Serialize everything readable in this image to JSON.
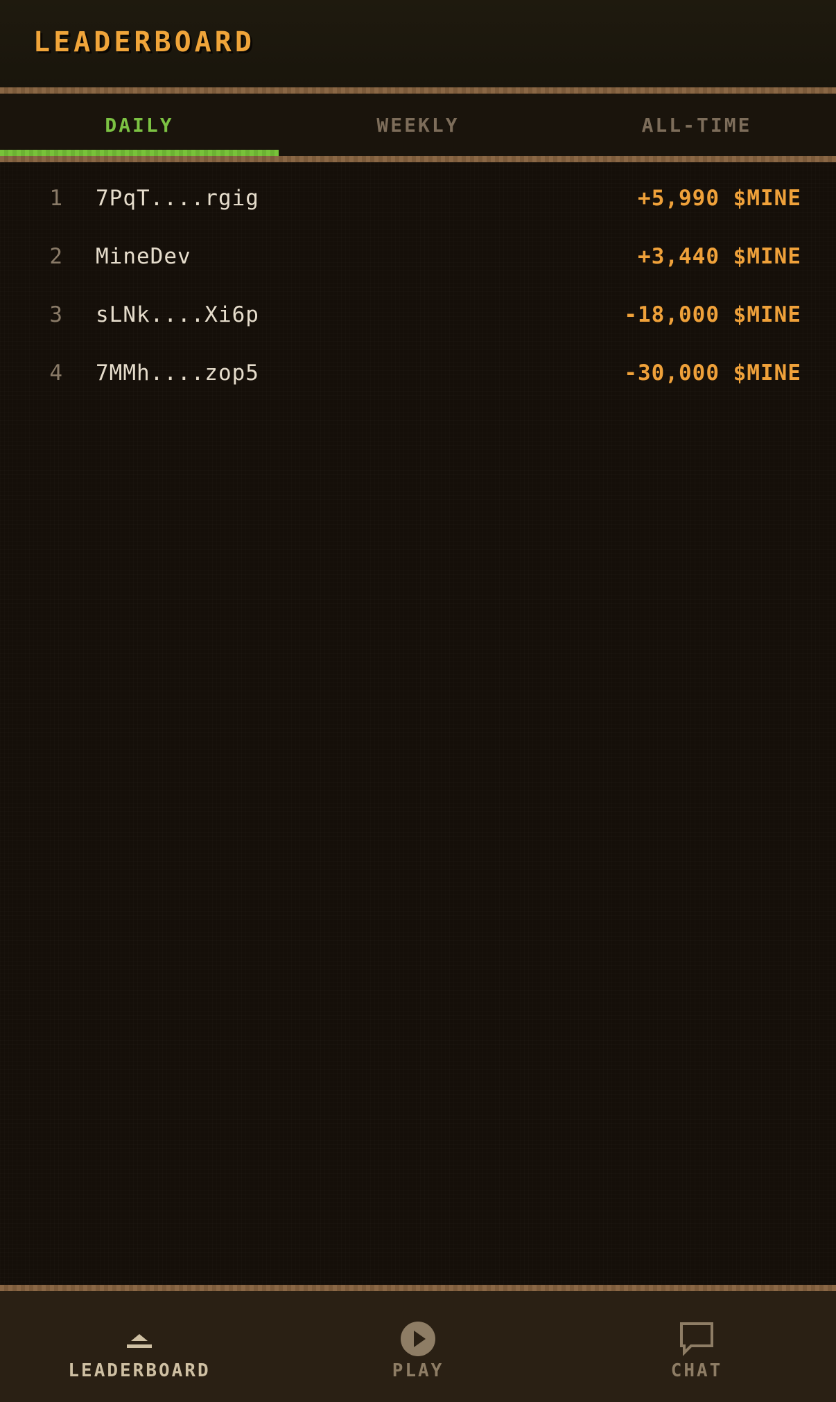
{
  "header": {
    "title": "LEADERBOARD"
  },
  "tabs": [
    {
      "label": "DAILY",
      "active": true
    },
    {
      "label": "WEEKLY",
      "active": false
    },
    {
      "label": "ALL-TIME",
      "active": false
    }
  ],
  "leaderboard": [
    {
      "rank": "1",
      "player": "7PqT....rgig",
      "score": "+5,990 $MINE"
    },
    {
      "rank": "2",
      "player": "MineDev",
      "score": "+3,440 $MINE"
    },
    {
      "rank": "3",
      "player": "sLNk....Xi6p",
      "score": "-18,000 $MINE"
    },
    {
      "rank": "4",
      "player": "7MMh....zop5",
      "score": "-30,000 $MINE"
    }
  ],
  "nav": [
    {
      "label": "LEADERBOARD",
      "icon": "leaderboard-icon",
      "active": true
    },
    {
      "label": "PLAY",
      "icon": "play-icon",
      "active": false
    },
    {
      "label": "CHAT",
      "icon": "chat-icon",
      "active": false
    }
  ],
  "colors": {
    "accent": "#f0a53a",
    "active_tab": "#7cc243",
    "divider": "#8a6745",
    "background": "#150f09"
  }
}
